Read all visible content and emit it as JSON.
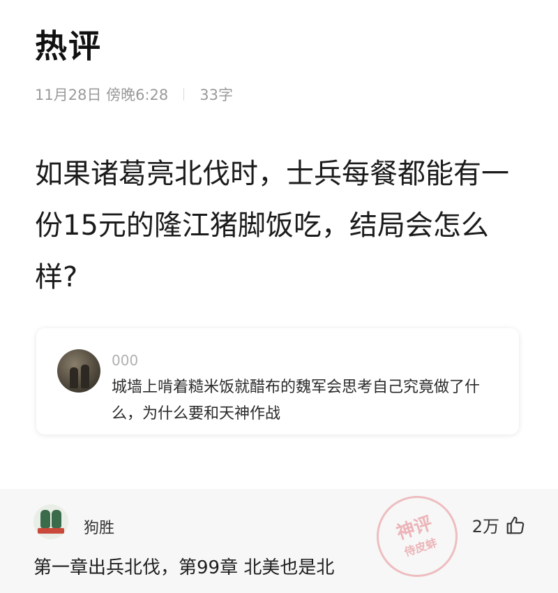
{
  "header": {
    "title": "热评",
    "date": "11月28日 傍晚6:28",
    "word_count": "33字"
  },
  "question": {
    "text": "如果诸葛亮北伐时，士兵每餐都能有一份15元的隆江猪脚饭吃，结局会怎么样?"
  },
  "quoted_comment": {
    "username": "000",
    "text": "城墙上啃着糙米饭就醋布的魏军会思考自己究竟做了什么，为什么要和天神作战"
  },
  "hot_comment": {
    "username": "狗胜",
    "likes": "2万",
    "text": "第一章出兵北伐，第99章 北美也是北",
    "like_icon": "thumbs-up-icon"
  },
  "watermark": {
    "line1": "神评",
    "line2": "侍皮蚌"
  }
}
